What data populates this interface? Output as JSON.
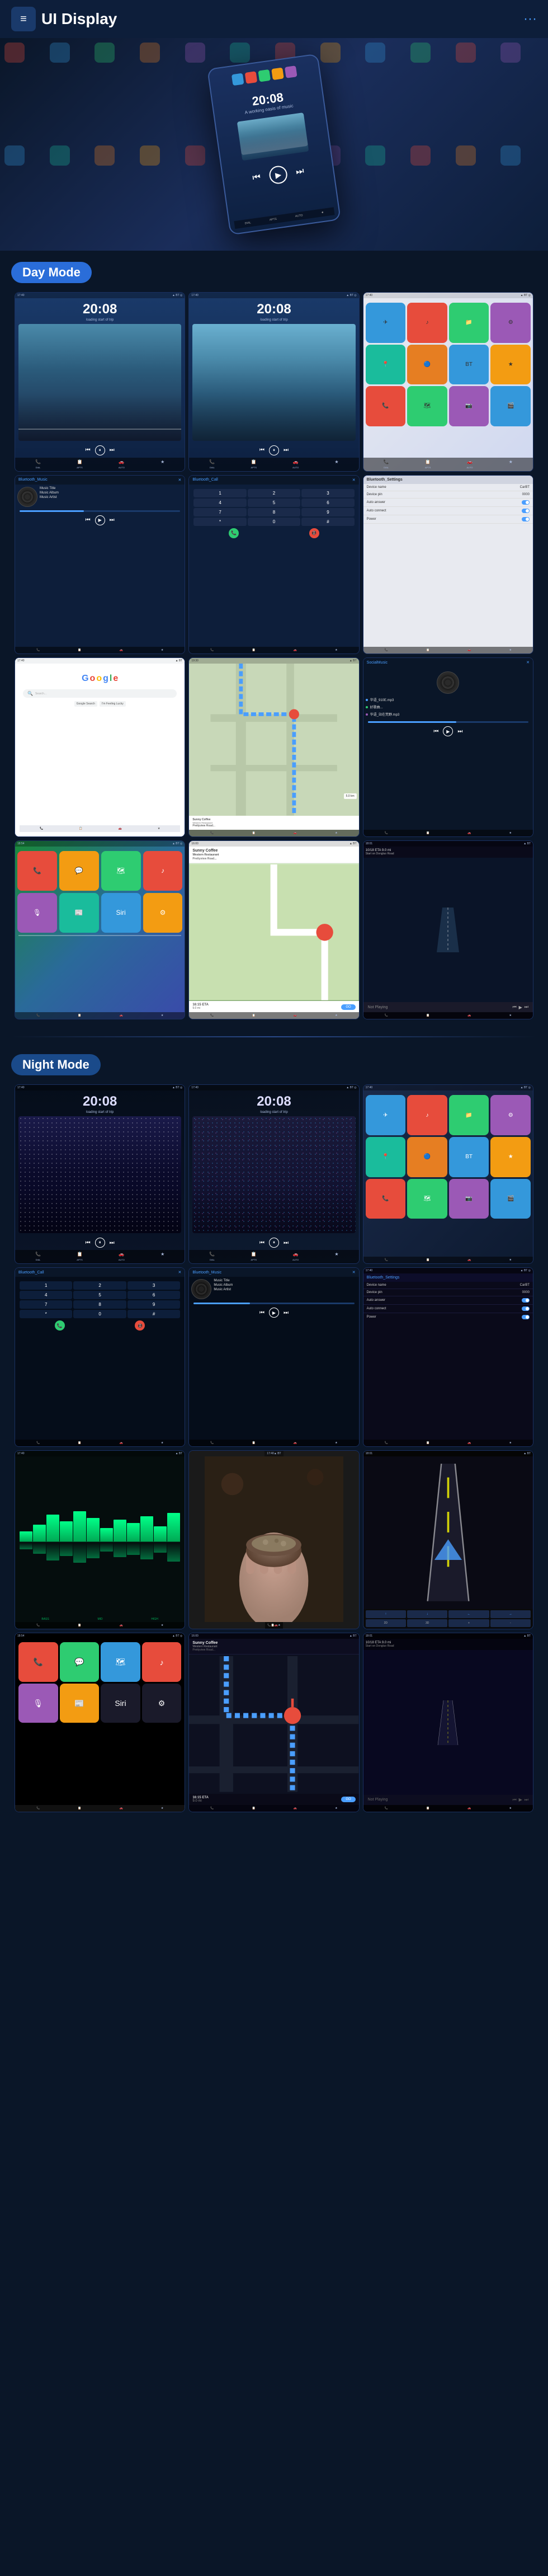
{
  "header": {
    "title": "UI Display",
    "menu_icon": "☰",
    "dots_icon": "···"
  },
  "day_mode": {
    "label": "Day Mode",
    "screens": [
      {
        "type": "music_player",
        "time": "20:08",
        "date": "loading start of trip",
        "variant": "mountain_day"
      },
      {
        "type": "music_player",
        "time": "20:08",
        "date": "loading start of trip",
        "variant": "mountain_day2"
      },
      {
        "type": "app_grid",
        "variant": "icons_day"
      },
      {
        "type": "bt_music",
        "title": "Bluetooth_Music",
        "track": "Music Title",
        "album": "Music Album",
        "artist": "Music Artist"
      },
      {
        "type": "bt_call",
        "title": "Bluetooth_Call"
      },
      {
        "type": "bt_settings",
        "title": "Bluetooth_Settings",
        "device_name": "CarBT",
        "device_pin": "0000"
      },
      {
        "type": "google",
        "variant": "google_day"
      },
      {
        "type": "map_route",
        "variant": "map_day"
      },
      {
        "type": "social_music",
        "variant": "social_day"
      },
      {
        "type": "ios_carplay",
        "variant": "ios_day"
      },
      {
        "type": "navigation",
        "title": "Sunny Coffee",
        "subtitle": "Western Restaurant",
        "address": "Prettyview Road...",
        "eta": "16:15 ETA",
        "distance": "9.0 mi",
        "go_label": "GO"
      },
      {
        "type": "not_playing",
        "variant": "not_playing_day",
        "distance_label": "10/18 ETA  9.0 mi",
        "road_label": "Start on Dongluo Road"
      }
    ]
  },
  "night_mode": {
    "label": "Night Mode",
    "screens": [
      {
        "type": "music_player",
        "time": "20:08",
        "date": "loading start of trip",
        "variant": "galaxy_night"
      },
      {
        "type": "music_player",
        "time": "20:08",
        "date": "loading start of trip",
        "variant": "galaxy_night2"
      },
      {
        "type": "app_grid",
        "variant": "icons_night"
      },
      {
        "type": "bt_call",
        "title": "Bluetooth_Call",
        "variant": "night"
      },
      {
        "type": "bt_music",
        "title": "Bluetooth_Music",
        "track": "Music Title",
        "album": "Music Album",
        "artist": "Music Artist",
        "variant": "night"
      },
      {
        "type": "bt_settings",
        "title": "Bluetooth_Settings",
        "device_name": "CarBT",
        "device_pin": "0000",
        "variant": "night"
      },
      {
        "type": "eq_visual",
        "variant": "eq_night"
      },
      {
        "type": "food_screen",
        "variant": "food"
      },
      {
        "type": "road_dark",
        "variant": "road_night"
      },
      {
        "type": "ios_carplay",
        "variant": "ios_night"
      },
      {
        "type": "navigation",
        "title": "Sunny Coffee",
        "subtitle": "Western Restaurant",
        "address": "Prettyview Road...",
        "eta": "16:15 ETA",
        "distance": "9.0 mi",
        "go_label": "GO",
        "variant": "night"
      },
      {
        "type": "not_playing",
        "variant": "not_playing_night",
        "distance_label": "10/18 ETA  9.0 mi",
        "road_label": "Start on Dongluo Road"
      }
    ]
  },
  "bottom_bar_items": [
    "DIAL",
    "APTS",
    "AUTO",
    "★"
  ],
  "status_bar": {
    "left": "17:40",
    "right_icons": [
      "wifi",
      "bt",
      "signal"
    ]
  }
}
